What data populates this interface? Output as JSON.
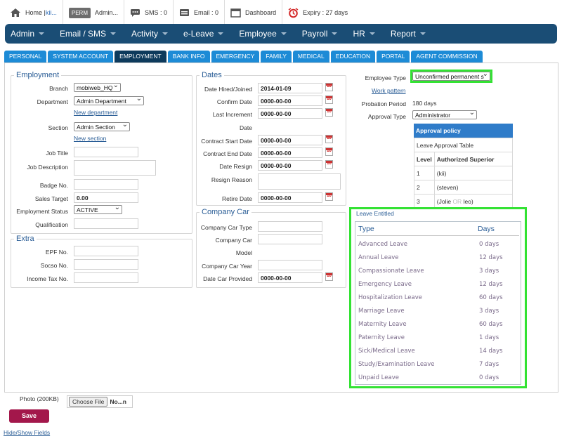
{
  "topbar": {
    "home_label": "Home |",
    "home_user": "kii...",
    "perm_badge": "PERM",
    "admin_label": "Admin...",
    "sms_label": "SMS : 0",
    "email_label": "Email : 0",
    "dashboard_label": "Dashboard",
    "expiry_label": "Expiry : 27 days"
  },
  "nav": [
    "Admin",
    "Email / SMS",
    "Activity",
    "e-Leave",
    "Employee",
    "Payroll",
    "HR",
    "Report"
  ],
  "tabs": [
    "PERSONAL",
    "SYSTEM ACCOUNT",
    "EMPLOYMENT",
    "BANK INFO",
    "EMERGENCY",
    "FAMILY",
    "MEDICAL",
    "EDUCATION",
    "PORTAL",
    "AGENT COMMISSION"
  ],
  "employment": {
    "legend": "Employment",
    "branch_label": "Branch",
    "branch_value": "mobiweb_HQ",
    "department_label": "Department",
    "department_value": "Admin Department",
    "new_department": "New department",
    "section_label": "Section",
    "section_value": "Admin Section",
    "new_section": "New section",
    "job_title_label": "Job Title",
    "job_desc_label": "Job Description",
    "badge_label": "Badge No.",
    "sales_target_label": "Sales Target",
    "sales_target_value": "0.00",
    "emp_status_label": "Employment Status",
    "emp_status_value": "ACTIVE",
    "qualification_label": "Qualification"
  },
  "extra": {
    "legend": "Extra",
    "epf_label": "EPF No.",
    "socso_label": "Socso No.",
    "tax_label": "Income Tax No."
  },
  "dates": {
    "legend": "Dates",
    "hired_label": "Date Hired/Joined",
    "hired_value": "2014-01-09",
    "confirm_label": "Confirm Date",
    "confirm_value": "0000-00-00",
    "last_inc_label": "Last Increment",
    "last_inc_label2": "Date",
    "last_inc_value": "0000-00-00",
    "contract_start_label": "Contract Start Date",
    "contract_start_value": "0000-00-00",
    "contract_end_label": "Contract End Date",
    "contract_end_value": "0000-00-00",
    "resign_label": "Date Resign",
    "resign_value": "0000-00-00",
    "resign_reason_label": "Resign Reason",
    "retire_label": "Retire Date",
    "retire_value": "0000-00-00"
  },
  "car": {
    "legend": "Company Car",
    "type_label": "Company Car Type",
    "model_label": "Company Car",
    "model_label2": "Model",
    "year_label": "Company Car Year",
    "provided_label": "Date Car Provided",
    "provided_value": "0000-00-00"
  },
  "right": {
    "emp_type_label": "Employee Type",
    "emp_type_value": "Unconfirmed permanent s",
    "work_pattern": "Work pattern",
    "probation_label": "Probation Period",
    "probation_value": "180 days",
    "approval_type_label": "Approval Type",
    "approval_type_value": "Administrator",
    "policy_header": "Approval policy",
    "policy_table_title": "Leave Approval Table",
    "col_level": "Level",
    "col_superior": "Authorized Superior",
    "rows": [
      {
        "level": "1",
        "superior": "(kii)"
      },
      {
        "level": "2",
        "superior": "(steven)"
      },
      {
        "level": "3",
        "superior_a": "(Jolie ",
        "superior_or": "OR",
        "superior_b": " leo)"
      }
    ]
  },
  "leave": {
    "title": "Leave Entitled",
    "col_type": "Type",
    "col_days": "Days",
    "rows": [
      {
        "type": "Advanced Leave",
        "days": "0 days"
      },
      {
        "type": "Annual Leave",
        "days": "12 days"
      },
      {
        "type": "Compassionate Leave",
        "days": "3 days"
      },
      {
        "type": "Emergency Leave",
        "days": "12 days"
      },
      {
        "type": "Hospitalization Leave",
        "days": "60 days"
      },
      {
        "type": "Marriage Leave",
        "days": "3 days"
      },
      {
        "type": "Maternity Leave",
        "days": "60 days"
      },
      {
        "type": "Paternity Leave",
        "days": "1 days"
      },
      {
        "type": "Sick/Medical Leave",
        "days": "14 days"
      },
      {
        "type": "Study/Examination Leave",
        "days": "7 days"
      },
      {
        "type": "Unpaid Leave",
        "days": "0 days"
      }
    ]
  },
  "bottom": {
    "photo_label": "Photo (200KB)",
    "choose_file": "Choose File",
    "file_name": "No...n",
    "save": "Save",
    "toggle": "Hide/Show Fields"
  },
  "colors": {
    "nav_bg": "#1a4d75",
    "tab_bg": "#1d8bd6",
    "tab_active": "#0d3a5c",
    "highlight": "#33e233",
    "save_bg": "#a3174b"
  }
}
